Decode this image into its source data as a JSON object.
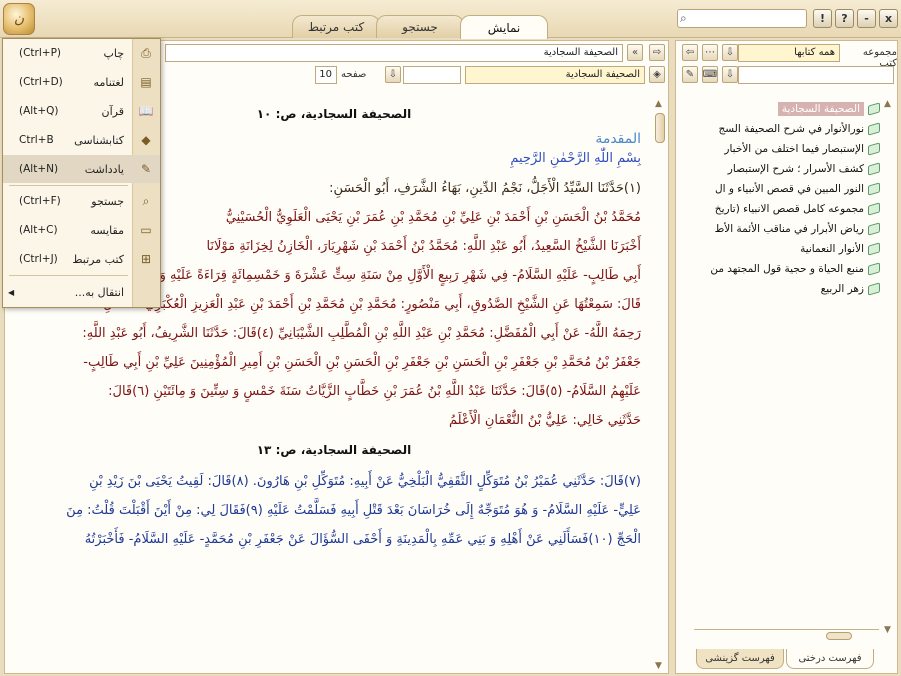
{
  "window": {
    "tabs": [
      {
        "label": "نمایش",
        "active": true
      },
      {
        "label": "جستجو",
        "active": false
      },
      {
        "label": "کتب مرتبط",
        "active": false
      }
    ],
    "buttons": {
      "help": "?",
      "info": "!",
      "minimize": "-",
      "close": "x"
    }
  },
  "toolbar": {
    "book_field": "الصحيفة السجادية",
    "section_field": "الصحيفة السجادية",
    "page_label": "صفحه",
    "page_value": "10"
  },
  "document": {
    "page_title_1": "الصحيفة السجادية، ص: ١٠",
    "heading": "المقدمة",
    "bismillah": "بِسْمِ اللّٰهِ الرَّحْمٰنِ الرَّحِيمِ",
    "para1": "(١)حَدَّثَنَا السَّيِّدُ الْأَجَلُّ، نَجْمُ الدِّينِ، بَهَاءُ الشَّرَفِ، أَبُو الْحَسَنِ:",
    "para2": "مُحَمَّدُ بْنُ الْحَسَنِ بْنِ أَحْمَدَ بْنِ عَلِيِّ بْنِ مُحَمَّدِ بْنِ عُمَرَ بْنِ يَحْيَى الْعَلَوِيُّ الْحُسَيْنِيُّ",
    "para3": "أَخْبَرَنَا الشَّيْخُ السَّعِيدُ، أَبُو عَبْدِ اللَّهِ: مُحَمَّدُ بْنُ أَحْمَدَ بْنِ شَهْرِيَارَ، الْخَازِنُ لِخِزَانَةِ مَوْلَانَا",
    "para4": "أَبِي طَالِبٍ- عَلَيْهِ السَّلَامُ- فِي شَهْرِ رَبِيعٍ الْأَوَّلِ مِنْ سَنَةِ سِتٍّ عَشْرَةَ وَ خَمْسِمِائَةٍ قِرَاءَةً عَلَيْهِ وَ أَنَا أَسْمَعُ. (٣)",
    "para5": "قَالَ: سَمِعْتُهَا عَنِ الشَّيْخِ الصَّدُوقِ، أَبِي مَنْصُورٍ: مُحَمَّدِ بْنِ مُحَمَّدِ بْنِ أَحْمَدَ بْنِ عَبْدِ الْعَزِيزِ الْعُكْبَرِيِّ الْمُعَدِّلِ-",
    "para6": "رَحِمَهُ اللَّهُ- عَنْ أَبِي الْمُفَضَّلِ: مُحَمَّدِ بْنِ عَبْدِ اللَّهِ بْنِ الْمُطَّلِبِ الشَّيْبَانِيِّ (٤)قَالَ: حَدَّثَنَا الشَّرِيفُ، أَبُو عَبْدِ اللَّهِ:",
    "para7": "جَعْفَرُ بْنُ مُحَمَّدِ بْنِ جَعْفَرِ بْنِ الْحَسَنِ بْنِ جَعْفَرِ بْنِ الْحَسَنِ بْنِ الْحَسَنِ بْنِ أَمِيرِ الْمُؤْمِنِينَ عَلِيِّ بْنِ أَبِي طَالِبٍ-",
    "para8": "عَلَيْهِمُ السَّلَامُ- (٥)قَالَ: حَدَّثَنَا عَبْدُ اللَّهِ بْنُ عُمَرَ بْنِ خَطَّابٍ الزَّيَّاتُ سَنَةَ خَمْسٍ وَ سِتِّينَ وَ مِائَتَيْنِ (٦)قَالَ:",
    "para9": "حَدَّثَنِي خَالِي: عَلِيُّ بْنُ النُّعْمَانِ الْأَعْلَمُ",
    "page_title_2": "الصحيفة السجادية، ص: ١٣",
    "para10": "(٧)قَالَ: حَدَّثَنِي عُمَيْرُ بْنُ مُتَوَكِّلٍ الثَّقَفِيُّ الْبَلْخِيُّ عَنْ أَبِيهِ: مُتَوَكِّلِ بْنِ هَارُونَ. (٨)قَالَ: لَقِيتُ يَحْيَى بْنَ زَيْدِ بْنِ",
    "para11": "عَلِيٍّ- عَلَيْهِ السَّلَامُ- وَ هُوَ مُتَوَجِّهٌ إِلَى خُرَاسَانَ بَعْدَ قَتْلِ أَبِيهِ فَسَلَّمْتُ عَلَيْهِ (٩)فَقَالَ لِي: مِنْ أَيْنَ أَقْبَلْتَ قُلْتُ: مِنَ",
    "para12": "الْحَجِّ (١٠)فَسَأَلَنِي عَنْ أَهْلِهِ وَ بَنِي عَمِّهِ بِالْمَدِينَةِ وَ أَحْفَى السُّؤَالَ عَنْ جَعْفَرِ بْنِ مُحَمَّدٍ- عَلَيْهِ السَّلَامُ- فَأَخْبَرْتُهُ"
  },
  "side": {
    "group_label": "مجموعه کتب",
    "group_value": "همه کتابها",
    "tree": [
      "الصحيفة السجادية",
      "نورالأنوار في شرح الصحيفة السج",
      "الإستبصار فيما اختلف من الأخبار",
      "كشف الأسرار ؛ شرح الإستبصار",
      "النور المبين في قصص الأنبياء و ال",
      "مجموعه كامل قصص الانبياء (تاريخ",
      "رياض الأبرار في مناقب الأئمة الأط",
      "الأنوار النعمانية",
      "منبع الحياة و حجية قول المجتهد من",
      "زهر الربيع"
    ],
    "tabs": [
      {
        "label": "فهرست درختی",
        "active": true
      },
      {
        "label": "فهرست گزینشی",
        "active": false
      }
    ]
  },
  "menu": {
    "items": [
      {
        "label": "چاپ",
        "shortcut": "(Ctrl+P)",
        "icon": "printer-icon"
      },
      {
        "label": "لغتنامه",
        "shortcut": "(Ctrl+D)",
        "icon": "dictionary-icon"
      },
      {
        "label": "قرآن",
        "shortcut": "(Alt+Q)",
        "icon": "quran-icon"
      },
      {
        "label": "کتابشناسی",
        "shortcut": "Ctrl+B",
        "icon": "bibliography-icon"
      },
      {
        "label": "یادداشت",
        "shortcut": "(Alt+N)",
        "icon": "note-icon"
      },
      {
        "label": "جستجو",
        "shortcut": "(Ctrl+F)",
        "icon": "search-icon"
      },
      {
        "label": "مقایسه",
        "shortcut": "(Alt+C)",
        "icon": "compare-icon"
      },
      {
        "label": "کتب مرتبط",
        "shortcut": "(Ctrl+J)",
        "icon": "related-books-icon"
      },
      {
        "label": "انتقال به..."
      }
    ]
  }
}
